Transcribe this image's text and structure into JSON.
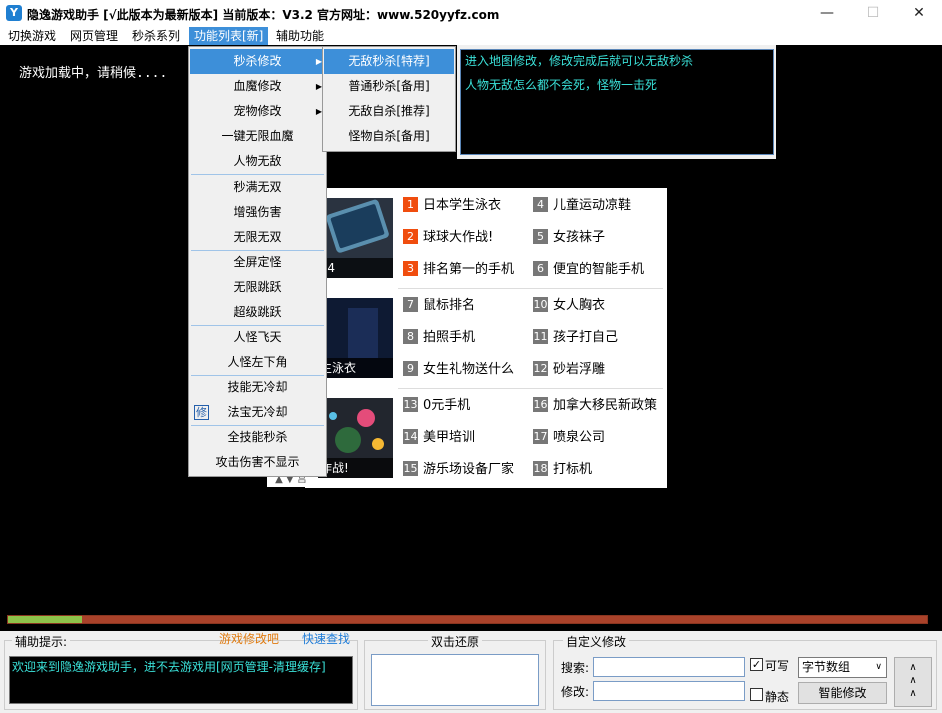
{
  "window": {
    "title": "隐逸游戏助手 [√此版本为最新版本] 当前版本：V3.2 官方网址：www.520yyfz.com",
    "icon": "app-logo-icon",
    "controls": [
      "minimize-icon",
      "maximize-icon",
      "close-icon"
    ]
  },
  "menubar": {
    "items": [
      {
        "label": "切换游戏"
      },
      {
        "label": "网页管理"
      },
      {
        "label": "秒杀系列"
      },
      {
        "label": "功能列表[新]",
        "active": true
      },
      {
        "label": "辅助功能"
      }
    ]
  },
  "game": {
    "loading_text": "游戏加载中，请稍候...."
  },
  "info_panel": {
    "lines": [
      "进入地图修改，修改完成后就可以无敌秒杀",
      "人物无敌怎么都不会死，怪物一击死"
    ]
  },
  "dropdown": {
    "items": [
      {
        "label": "秒杀修改",
        "submenu": true,
        "highlighted": true
      },
      {
        "label": "血魔修改",
        "submenu": true
      },
      {
        "label": "宠物修改",
        "submenu": true
      },
      {
        "label": "一键无限血魔"
      },
      {
        "label": "人物无敌"
      },
      {
        "label": "秒满无双"
      },
      {
        "label": "增强伤害"
      },
      {
        "label": "无限无双"
      },
      {
        "label": "全屏定怪"
      },
      {
        "label": "无限跳跃"
      },
      {
        "label": "超级跳跃"
      },
      {
        "label": "人怪飞天"
      },
      {
        "label": "人怪左下角"
      },
      {
        "label": "技能无冷却"
      },
      {
        "label": "法宝无冷却",
        "icon_text": "修"
      },
      {
        "label": "全技能秒杀"
      },
      {
        "label": "攻击伤害不显示"
      }
    ],
    "submenu": [
      {
        "label": "无敌秒杀[特荐]",
        "highlighted": true
      },
      {
        "label": "普通秒杀[备用]"
      },
      {
        "label": "无敌自杀[推荐]"
      },
      {
        "label": "怪物自杀[备用]"
      }
    ]
  },
  "news": {
    "thumbs": [
      {
        "caption": "e4"
      },
      {
        "caption": "生泳衣"
      },
      {
        "caption": "作战!"
      }
    ],
    "items": [
      {
        "n": "1",
        "text": "日本学生泳衣",
        "top": true
      },
      {
        "n": "4",
        "text": "儿童运动凉鞋"
      },
      {
        "n": "2",
        "text": "球球大作战!",
        "top": true
      },
      {
        "n": "5",
        "text": "女孩袜子"
      },
      {
        "n": "3",
        "text": "排名第一的手机",
        "top": true
      },
      {
        "n": "6",
        "text": "便宜的智能手机"
      },
      {
        "n": "7",
        "text": "鼠标排名"
      },
      {
        "n": "10",
        "text": "女人胸衣"
      },
      {
        "n": "8",
        "text": "拍照手机"
      },
      {
        "n": "11",
        "text": "孩子打自己"
      },
      {
        "n": "9",
        "text": "女生礼物送什么"
      },
      {
        "n": "12",
        "text": "砂岩浮雕"
      },
      {
        "n": "13",
        "text": "0元手机"
      },
      {
        "n": "16",
        "text": "加拿大移民新政策"
      },
      {
        "n": "14",
        "text": "美甲培训"
      },
      {
        "n": "17",
        "text": "喷泉公司"
      },
      {
        "n": "15",
        "text": "游乐场设备厂家"
      },
      {
        "n": "18",
        "text": "打标机"
      }
    ],
    "badge": "▲ ▼ 宫"
  },
  "progress": {
    "value": 0.08
  },
  "bottom": {
    "tips_label": "辅助提示:",
    "tips_link1": "游戏修改吧",
    "tips_link2": "快速查找",
    "tips_text": "欢迎来到隐逸游戏助手，进不去游戏用[网页管理-清理缓存]",
    "restore_label": "双击还原",
    "custom_label": "自定义修改",
    "search_label": "搜索:",
    "modify_label": "修改:",
    "writable_label": "可写",
    "writable_checked": true,
    "static_label": "静态",
    "static_checked": false,
    "type_select": "字节数组",
    "smart_button": "智能修改"
  }
}
